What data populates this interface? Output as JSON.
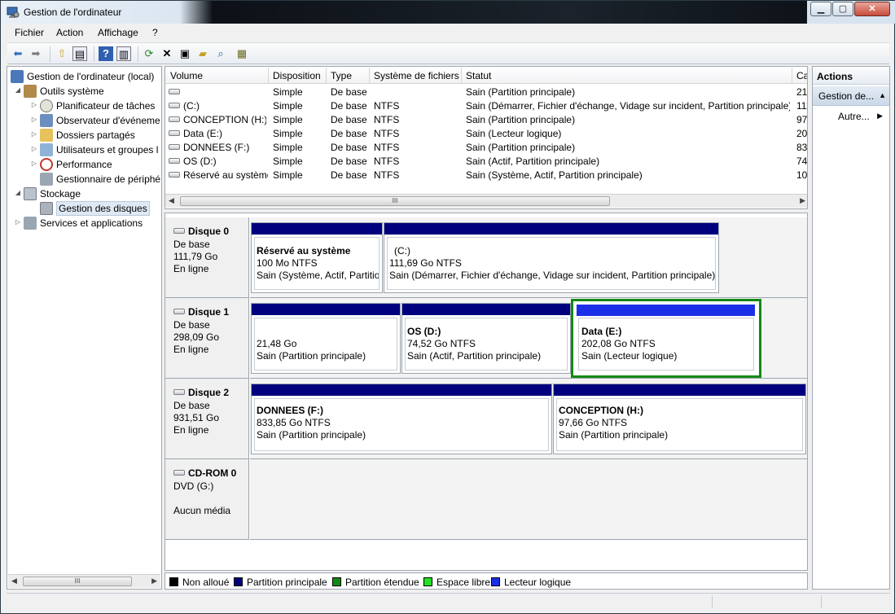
{
  "window": {
    "title": "Gestion de l'ordinateur"
  },
  "menu": [
    "Fichier",
    "Action",
    "Affichage",
    "?"
  ],
  "toolbar_icons": [
    "back-icon",
    "forward-icon",
    "up-icon",
    "show-hide-tree-icon",
    "help-icon",
    "show-hide-action-pane-icon",
    "refresh-icon",
    "delete-icon",
    "properties-icon",
    "open-icon",
    "search-icon",
    "export-icon"
  ],
  "tree": {
    "root": "Gestion de l'ordinateur (local)",
    "outils": "Outils système",
    "planificateur": "Planificateur de tâches",
    "observateur": "Observateur d'événeme",
    "dossiers": "Dossiers partagés",
    "utilisateurs": "Utilisateurs et groupes l",
    "performance": "Performance",
    "gestionnaire": "Gestionnaire de périphé",
    "stockage": "Stockage",
    "gestion_disques": "Gestion des disques",
    "services": "Services et applications"
  },
  "volume_list": {
    "columns": [
      "Volume",
      "Disposition",
      "Type",
      "Système de fichiers",
      "Statut",
      "Ca"
    ],
    "rows": [
      {
        "volume": "",
        "disposition": "Simple",
        "type": "De base",
        "fs": "",
        "statut": "Sain (Partition principale)",
        "cap": "21,"
      },
      {
        "volume": "(C:)",
        "disposition": "Simple",
        "type": "De base",
        "fs": "NTFS",
        "statut": "Sain (Démarrer, Fichier d'échange, Vidage sur incident, Partition principale)",
        "cap": "111"
      },
      {
        "volume": "CONCEPTION (H:)",
        "disposition": "Simple",
        "type": "De base",
        "fs": "NTFS",
        "statut": "Sain (Partition principale)",
        "cap": "97,"
      },
      {
        "volume": "Data (E:)",
        "disposition": "Simple",
        "type": "De base",
        "fs": "NTFS",
        "statut": "Sain (Lecteur logique)",
        "cap": "202"
      },
      {
        "volume": "DONNEES (F:)",
        "disposition": "Simple",
        "type": "De base",
        "fs": "NTFS",
        "statut": "Sain (Partition principale)",
        "cap": "833"
      },
      {
        "volume": "OS (D:)",
        "disposition": "Simple",
        "type": "De base",
        "fs": "NTFS",
        "statut": "Sain (Actif, Partition principale)",
        "cap": "74,"
      },
      {
        "volume": "Réservé au système",
        "disposition": "Simple",
        "type": "De base",
        "fs": "NTFS",
        "statut": "Sain (Système, Actif, Partition principale)",
        "cap": "100"
      }
    ]
  },
  "disks": {
    "d0": {
      "name": "Disque 0",
      "type": "De base",
      "size": "111,79 Go",
      "state": "En ligne",
      "p1": {
        "title": "Réservé au système",
        "size": "100 Mo NTFS",
        "status": "Sain (Système, Actif, Partitio"
      },
      "p2": {
        "title": "(C:)",
        "size": "111,69 Go NTFS",
        "status": "Sain (Démarrer, Fichier d'échange, Vidage sur incident, Partition principale)"
      }
    },
    "d1": {
      "name": "Disque 1",
      "type": "De base",
      "size": "298,09 Go",
      "state": "En ligne",
      "p1": {
        "size": "21,48 Go",
        "status": "Sain (Partition principale)"
      },
      "p2": {
        "title": "OS  (D:)",
        "size": "74,52 Go NTFS",
        "status": "Sain (Actif, Partition principale)"
      },
      "p3": {
        "title": "Data  (E:)",
        "size": "202,08 Go NTFS",
        "status": "Sain (Lecteur logique)"
      }
    },
    "d2": {
      "name": "Disque 2",
      "type": "De base",
      "size": "931,51 Go",
      "state": "En ligne",
      "p1": {
        "title": "DONNEES  (F:)",
        "size": "833,85 Go NTFS",
        "status": "Sain (Partition principale)"
      },
      "p2": {
        "title": "CONCEPTION  (H:)",
        "size": "97,66 Go NTFS",
        "status": "Sain (Partition principale)"
      }
    },
    "cd": {
      "name": "CD-ROM 0",
      "drive": "DVD (G:)",
      "media": "Aucun média"
    }
  },
  "legend": [
    {
      "label": "Non alloué",
      "color": "#000000"
    },
    {
      "label": "Partition principale",
      "color": "#00007f"
    },
    {
      "label": "Partition étendue",
      "color": "#128a14"
    },
    {
      "label": "Espace libre",
      "color": "#26e026"
    },
    {
      "label": "Lecteur logique",
      "color": "#1b2ee8"
    }
  ],
  "actions": {
    "title": "Actions",
    "group": "Gestion de...",
    "more": "Autre..."
  },
  "colors": {
    "primary_partition": "#00007f",
    "logical_drive": "#1b2ee8",
    "selection": "#128a14"
  }
}
